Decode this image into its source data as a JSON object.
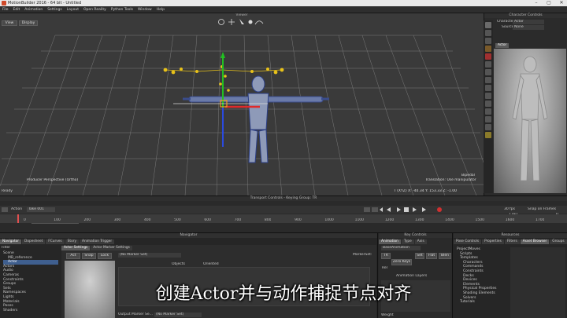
{
  "window": {
    "title": "MotionBuilder 2016 - 64 bit - Untitled",
    "controls": [
      "–",
      "▢",
      "✕"
    ]
  },
  "menu": [
    "File",
    "Edit",
    "Animation",
    "Settings",
    "Layout",
    "Open Reality",
    "Python Tools",
    "Window",
    "Help"
  ],
  "viewport": {
    "title": "Viewer",
    "view_button": "View",
    "display_button": "Display",
    "camera_label": "Producer Perspective (Ortho)",
    "manipulator_label": "Translation: Use manipulator",
    "bipedal_label": "Bipedal",
    "coord_readout": "T  (XYZ)  X: -40.34  Y: 153.33  Z: -1.00",
    "status_left": "Ready"
  },
  "character_controls": {
    "title": "Character Controls",
    "character_label": "Character",
    "character_value": "Actor",
    "source_label": "Source",
    "source_value": "None",
    "tab": "Actor"
  },
  "transport": {
    "title": "Transport Controls  -  Keying Group: TR",
    "action_label": "Action",
    "take_value": "Take 001",
    "fps": "30 fps",
    "time_display": "Snap on Frames",
    "frame_start": "0",
    "frame_end": "1797",
    "frame_current": "0",
    "take_name": "Take Maya Keys For Edit",
    "ruler": [
      "0",
      "100",
      "200",
      "300",
      "400",
      "500",
      "600",
      "700",
      "800",
      "900",
      "1000",
      "1100",
      "1200",
      "1300",
      "1400",
      "1500",
      "1600",
      "1700"
    ]
  },
  "navigator": {
    "title": "Navigator",
    "tabs": [
      "Navigator",
      "Dopesheet",
      "FCurves",
      "Story",
      "Animation Trigger"
    ],
    "filter_label": "Filter",
    "tree": [
      "Scene",
      "MB_reference",
      "Actor",
      "Actors",
      "Audio",
      "Cameras",
      "Constraints",
      "Groups",
      "Sets",
      "Namespaces",
      "Lights",
      "Materials",
      "Poses",
      "Shaders"
    ],
    "actor_tabs": [
      "Actor Settings",
      "Actor Marker Settings"
    ],
    "actor_buttons": [
      "Act",
      "Snap",
      "Lock"
    ],
    "marker_set_value": "(No Marker Set)",
    "marker_set_label": "MarkerSet:",
    "table_headers": [
      "Objects",
      "Oriented"
    ],
    "output_marker": "Output Marker Se...",
    "output_marker_value": "(No Marker Set)"
  },
  "key_controls": {
    "title": "Key Controls",
    "tabs": [
      "Animation",
      "Type",
      "Axis"
    ],
    "base_label": "BaseAnimation",
    "keys_row": [
      "Zero Keys",
      "Rel"
    ],
    "filter_buttons": [
      "TR",
      "Set",
      "Flat",
      "Blen"
    ],
    "layers_title": "Animation Layers",
    "weight_label": "Weight"
  },
  "resources": {
    "title": "Resources",
    "tabs": [
      "Pose Controls",
      "Properties",
      "Filters",
      "Asset Browser",
      "Groups"
    ],
    "tree": [
      "Templates",
      "Characters",
      "Commands",
      "Constraints",
      "Decks",
      "Devices",
      "Elements",
      "Physical Properties",
      "Shading Elements",
      "Solvers",
      "Tutorials"
    ],
    "root": "ProjectMoves",
    "scripts": "Scripts"
  },
  "subtitle": "创建Actor并与动作捕捉节点对齐"
}
